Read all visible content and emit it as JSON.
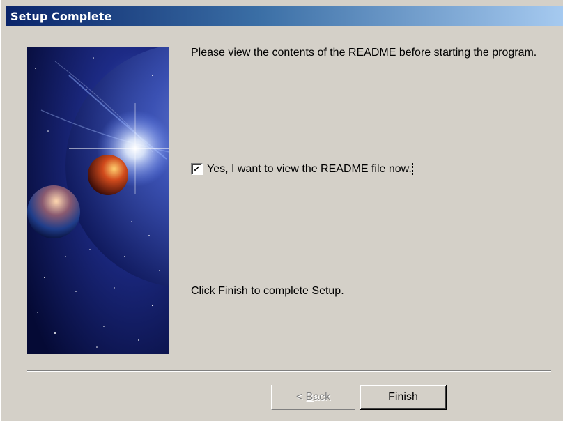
{
  "window": {
    "title": "Setup Complete"
  },
  "content": {
    "intro_text": "Please view the contents of the README before starting the program.",
    "checkbox": {
      "label": "Yes, I want to view the README file now.",
      "checked": true
    },
    "finish_text": "Click Finish to complete Setup."
  },
  "buttons": {
    "back_prefix": "< ",
    "back_mnemonic": "B",
    "back_rest": "ack",
    "back_enabled": false,
    "finish_label": "Finish"
  },
  "colors": {
    "title_bar_start": "#0a246a",
    "title_bar_end": "#a6caf0",
    "dialog_background": "#d4d0c8"
  }
}
